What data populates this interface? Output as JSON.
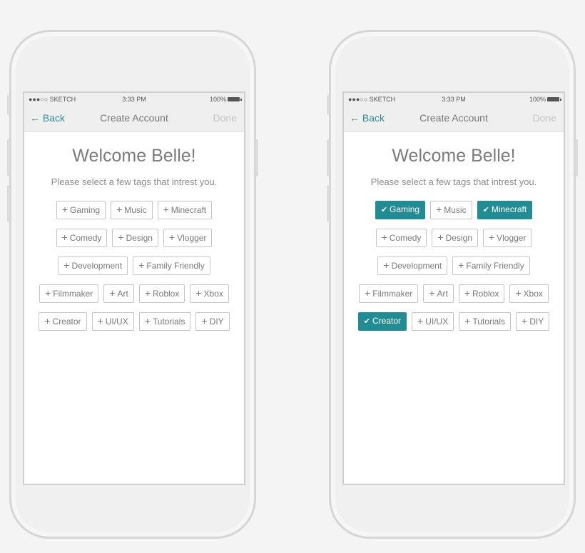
{
  "colors": {
    "accent": "#218c93",
    "back_link": "#2f8f96",
    "tag_border": "#c4c4c4",
    "page_background": "#f4f4f4"
  },
  "phones": [
    {
      "status": {
        "carrier": "●●●○○ SKETCH",
        "time": "3:33 PM",
        "battery": "100%"
      },
      "nav": {
        "back_label": "← Back",
        "title": "Create Account",
        "done_label": "Done"
      },
      "welcome": "Welcome Belle!",
      "subtitle": "Please select a few tags that intrest you.",
      "tag_rows": [
        [
          {
            "label": "Gaming",
            "selected": false
          },
          {
            "label": "Music",
            "selected": false
          },
          {
            "label": "Minecraft",
            "selected": false
          }
        ],
        [
          {
            "label": "Comedy",
            "selected": false
          },
          {
            "label": "Design",
            "selected": false
          },
          {
            "label": "Vlogger",
            "selected": false
          }
        ],
        [
          {
            "label": "Development",
            "selected": false
          },
          {
            "label": "Family Friendly",
            "selected": false
          }
        ],
        [
          {
            "label": "Filmmaker",
            "selected": false
          },
          {
            "label": "Art",
            "selected": false
          },
          {
            "label": "Roblox",
            "selected": false
          },
          {
            "label": "Xbox",
            "selected": false
          }
        ],
        [
          {
            "label": "Creator",
            "selected": false
          },
          {
            "label": "UI/UX",
            "selected": false
          },
          {
            "label": "Tutorials",
            "selected": false
          },
          {
            "label": "DIY",
            "selected": false
          }
        ]
      ]
    },
    {
      "status": {
        "carrier": "●●●○○ SKETCH",
        "time": "3:33 PM",
        "battery": "100%"
      },
      "nav": {
        "back_label": "← Back",
        "title": "Create Account",
        "done_label": "Done"
      },
      "welcome": "Welcome Belle!",
      "subtitle": "Please select a few tags that intrest you.",
      "tag_rows": [
        [
          {
            "label": "Gaming",
            "selected": true
          },
          {
            "label": "Music",
            "selected": false
          },
          {
            "label": "Minecraft",
            "selected": true
          }
        ],
        [
          {
            "label": "Comedy",
            "selected": false
          },
          {
            "label": "Design",
            "selected": false
          },
          {
            "label": "Vlogger",
            "selected": false
          }
        ],
        [
          {
            "label": "Development",
            "selected": false
          },
          {
            "label": "Family Friendly",
            "selected": false
          }
        ],
        [
          {
            "label": "Filmmaker",
            "selected": false
          },
          {
            "label": "Art",
            "selected": false
          },
          {
            "label": "Roblox",
            "selected": false
          },
          {
            "label": "Xbox",
            "selected": false
          }
        ],
        [
          {
            "label": "Creator",
            "selected": true
          },
          {
            "label": "UI/UX",
            "selected": false
          },
          {
            "label": "Tutorials",
            "selected": false
          },
          {
            "label": "DIY",
            "selected": false
          }
        ]
      ]
    }
  ]
}
